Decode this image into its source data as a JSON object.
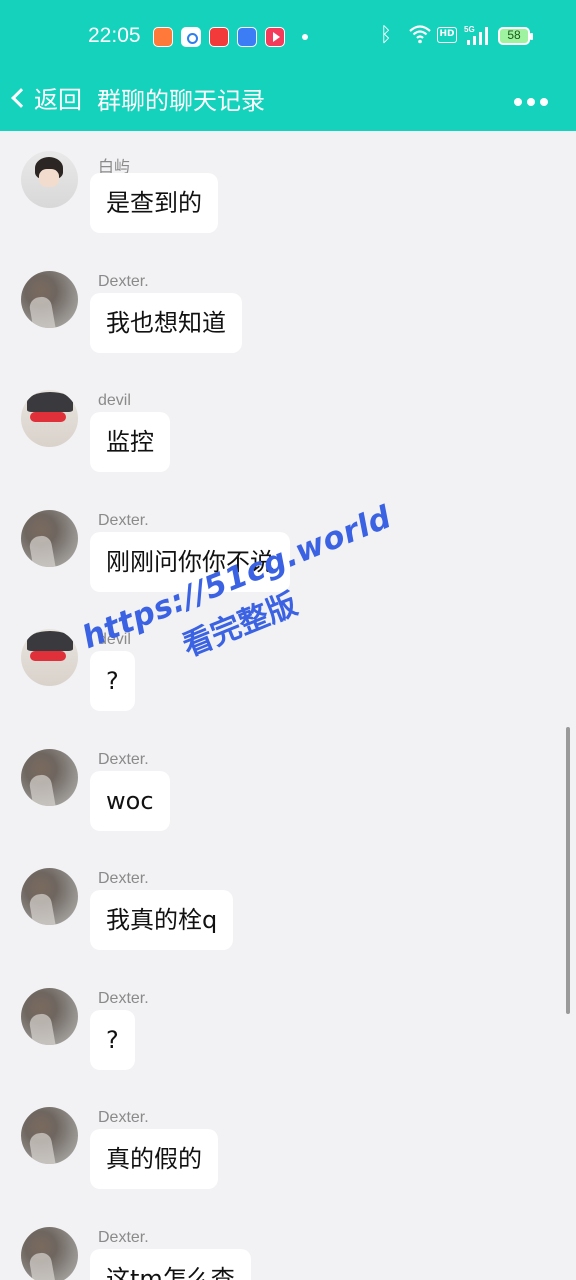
{
  "status_bar": {
    "time": "22:05",
    "app_icons": [
      "photo-app-icon",
      "camera-app-icon",
      "shop-app-icon",
      "infinity-app-icon",
      "video-app-icon"
    ],
    "hd_label": "HD",
    "network": "5G",
    "battery_level": "58"
  },
  "nav": {
    "back_label": "返回",
    "title": "群聊的聊天记录",
    "more_icon": "more-dots-icon"
  },
  "colors": {
    "header_bg": "#15d2bd",
    "page_bg": "#f2f2f4",
    "bubble_bg": "#ffffff",
    "watermark": "#3a62e3"
  },
  "messages": [
    {
      "sender": "白屿",
      "avatar": "bai",
      "text": "是查到的"
    },
    {
      "sender": "Dexter.",
      "avatar": "dexter",
      "text": "我也想知道"
    },
    {
      "sender": "devil",
      "avatar": "devil",
      "text": "监控"
    },
    {
      "sender": "Dexter.",
      "avatar": "dexter",
      "text": "刚刚问你你不说"
    },
    {
      "sender": "devil",
      "avatar": "devil",
      "text": "?"
    },
    {
      "sender": "Dexter.",
      "avatar": "dexter",
      "text": "woc"
    },
    {
      "sender": "Dexter.",
      "avatar": "dexter",
      "text": "我真的栓q"
    },
    {
      "sender": "Dexter.",
      "avatar": "dexter",
      "text": "?"
    },
    {
      "sender": "Dexter.",
      "avatar": "dexter",
      "text": "真的假的"
    },
    {
      "sender": "Dexter.",
      "avatar": "dexter",
      "text": "这tm怎么查"
    }
  ],
  "watermark": {
    "url": "https://51cg.world",
    "subtitle": "看完整版"
  }
}
